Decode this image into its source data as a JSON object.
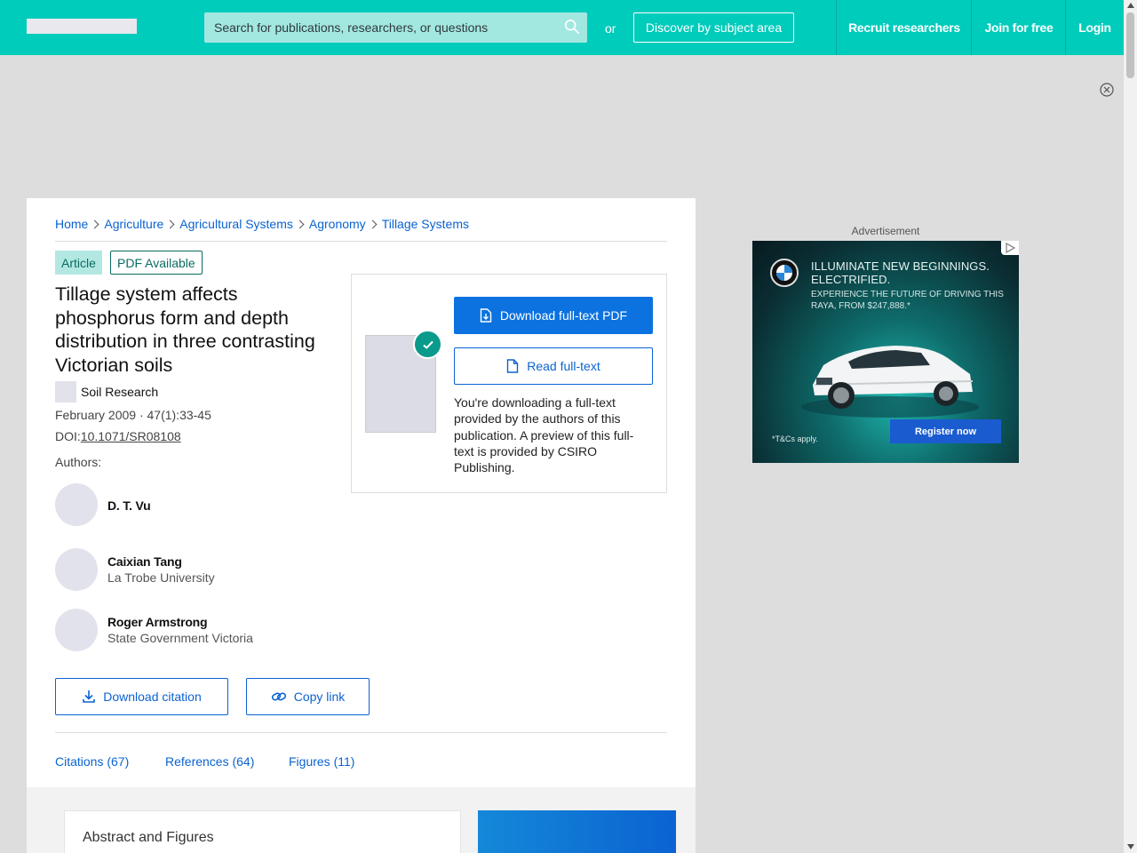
{
  "topbar": {
    "search_placeholder": "Search for publications, researchers, or questions",
    "or_text": "or",
    "discover_label": "Discover by subject area",
    "nav": {
      "recruit": "Recruit researchers",
      "join": "Join for free",
      "login": "Login"
    },
    "brand_color": "#00ccbb"
  },
  "breadcrumb": [
    "Home",
    "Agriculture",
    "Agricultural Systems",
    "Agronomy",
    "Tillage Systems"
  ],
  "badges": {
    "type": "Article",
    "availability": "PDF Available"
  },
  "article": {
    "title": "Tillage system affects phosphorus form and depth distribution in three contrasting Victorian soils",
    "journal": "Soil Research",
    "date_issue": "February 2009 · 47(1):33-45",
    "doi_label": "DOI:",
    "doi": "10.1071/SR08108",
    "authors_label": "Authors:",
    "authors": [
      {
        "name": "D. T. Vu",
        "affiliation": ""
      },
      {
        "name": "Caixian Tang",
        "affiliation": "La Trobe University"
      },
      {
        "name": "Roger Armstrong",
        "affiliation": "State Government Victoria"
      }
    ]
  },
  "actions": {
    "download_citation": "Download citation",
    "copy_link": "Copy link"
  },
  "download_panel": {
    "download_pdf": "Download full-text PDF",
    "read_fulltext": "Read full-text",
    "note": "You're downloading a full-text provided by the authors of this publication. A preview of this full-text is provided by CSIRO Publishing."
  },
  "tabs": {
    "citations": "Citations (67)",
    "references": "References (64)",
    "figures": "Figures (11)"
  },
  "abstract_section_title": "Abstract and Figures",
  "advertisement": {
    "label": "Advertisement",
    "headline": "ILLUMINATE NEW BEGINNINGS. ELECTRIFIED.",
    "subline": "EXPERIENCE THE FUTURE OF DRIVING THIS RAYA, FROM $247,888.*",
    "cta": "Register now",
    "terms": "*T&Cs apply."
  }
}
